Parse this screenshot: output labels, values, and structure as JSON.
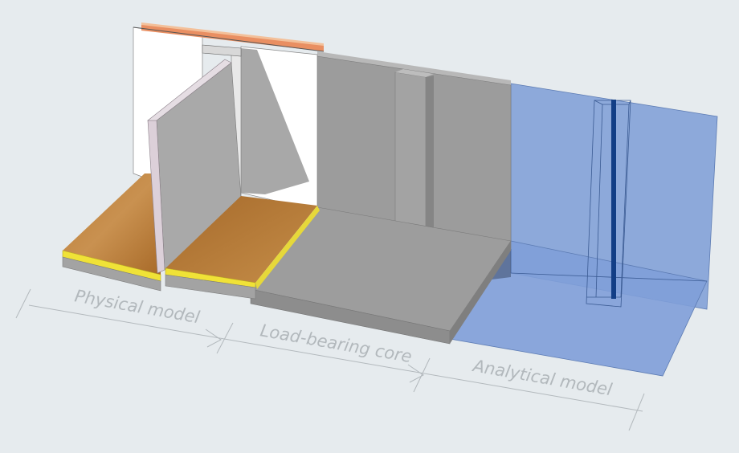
{
  "labels": {
    "physical": "Physical model",
    "core": "Load-bearing core",
    "analytical": "Analytical model"
  },
  "colors": {
    "background": "#e6ebee",
    "wood": "#c98f45",
    "insulation": "#f2e33a",
    "concrete": "#9a9a9a",
    "drywall": "#d9cfd7",
    "analytical": "#7f9fd6",
    "analytical_line": "#123e86"
  }
}
